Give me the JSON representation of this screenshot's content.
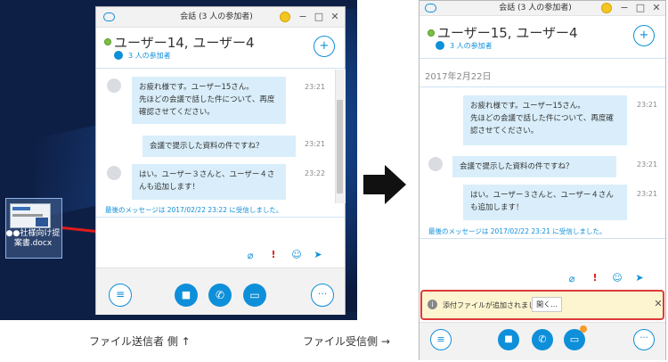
{
  "desktop": {
    "file_icon_label": "●●社様向け提案書.docx"
  },
  "sender": {
    "title": "会話 (3 人の参加者)",
    "participants": "ユーザー14, ユーザー4",
    "participants_count": "3 人の参加者",
    "messages": [
      {
        "text": "お疲れ様です。ユーザー15さん。\n先ほどの会議で話した件について、再度確認させてください。",
        "time": "23:21"
      },
      {
        "text": "会議で提示した資料の件ですね？",
        "time": "23:21"
      },
      {
        "text": "はい。ユーザー３さんと、ユーザー４さんも追加します！",
        "time": "23:22"
      }
    ],
    "last_message": "最後のメッセージは 2017/02/22 23:22 に受信しました。"
  },
  "receiver": {
    "title": "会話 (3 人の参加者)",
    "participants": "ユーザー15, ユーザー4",
    "participants_count": "3 人の参加者",
    "date": "2017年2月22日",
    "messages": [
      {
        "text": "お疲れ様です。ユーザー15さん。\n先ほどの会議で話した件について、再度確認させてください。",
        "time": "23:21"
      },
      {
        "text": "会議で提示した資料の件ですね？",
        "time": "23:21"
      },
      {
        "text": "はい。ユーザー３さんと、ユーザー４さんも追加します！",
        "time": "23:21"
      }
    ],
    "last_message": "最後のメッセージは 2017/02/22 23:21 に受信しました。",
    "notification": "添付ファイルが追加されました。",
    "open_button": "開く..."
  },
  "captions": {
    "sender_side": "ファイル送信者 側 ↑",
    "receiver_side": "ファイル受信側 →"
  },
  "icons": {
    "chat": "chat-icon",
    "emoji": "smile-icon",
    "minimize": "minimize-icon",
    "maximize": "maximize-icon",
    "close": "close-icon",
    "add_person": "add-person-icon",
    "attach": "paperclip-icon",
    "important": "exclamation-icon",
    "send": "send-icon",
    "video": "video-icon",
    "call": "phone-icon",
    "present": "monitor-icon",
    "more": "more-icon",
    "info": "info-icon"
  },
  "colors": {
    "accent": "#0e8fd9",
    "bubble": "#d9eefa",
    "notify_bg": "#fdf5cf",
    "highlight": "#e03a3a",
    "online": "#7ac143"
  }
}
